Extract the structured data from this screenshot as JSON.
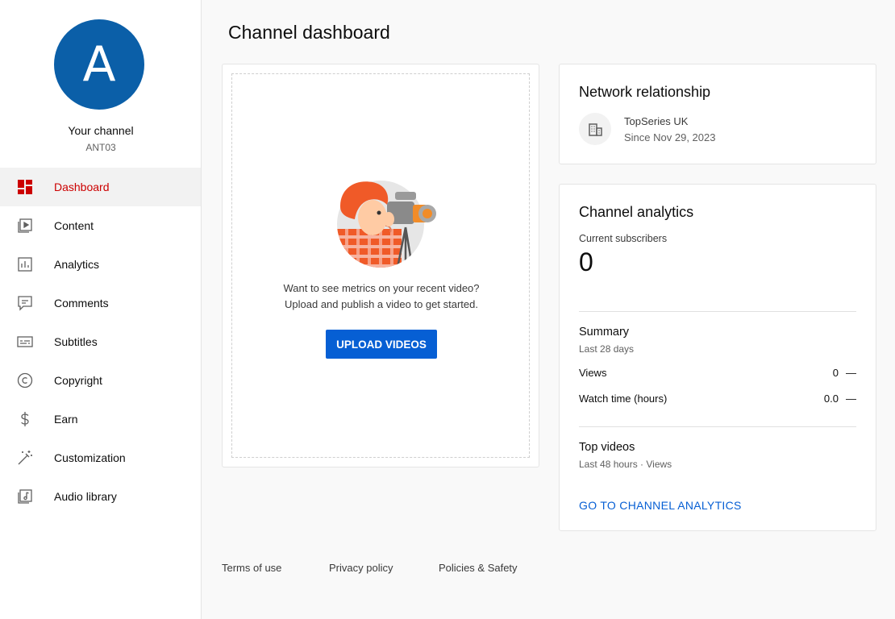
{
  "sidebar": {
    "avatar_letter": "A",
    "channel_title": "Your channel",
    "channel_handle": "ANT03",
    "items": [
      {
        "label": "Dashboard",
        "icon": "dashboard-icon",
        "active": true
      },
      {
        "label": "Content",
        "icon": "content-icon"
      },
      {
        "label": "Analytics",
        "icon": "analytics-icon"
      },
      {
        "label": "Comments",
        "icon": "comments-icon"
      },
      {
        "label": "Subtitles",
        "icon": "subtitles-icon"
      },
      {
        "label": "Copyright",
        "icon": "copyright-icon"
      },
      {
        "label": "Earn",
        "icon": "earn-icon"
      },
      {
        "label": "Customization",
        "icon": "customization-icon"
      },
      {
        "label": "Audio library",
        "icon": "audio-library-icon"
      }
    ]
  },
  "main": {
    "page_title": "Channel dashboard",
    "upload_card": {
      "line1": "Want to see metrics on your recent video?",
      "line2": "Upload and publish a video to get started.",
      "button_label": "UPLOAD VIDEOS"
    },
    "network_card": {
      "title": "Network relationship",
      "network_name": "TopSeries UK",
      "since": "Since Nov 29, 2023"
    },
    "analytics_card": {
      "title": "Channel analytics",
      "subscribers_label": "Current subscribers",
      "subscribers_value": "0",
      "summary_title": "Summary",
      "summary_period": "Last 28 days",
      "rows": [
        {
          "label": "Views",
          "value": "0",
          "trend": "—"
        },
        {
          "label": "Watch time (hours)",
          "value": "0.0",
          "trend": "—"
        }
      ],
      "top_videos_title": "Top videos",
      "top_videos_period": "Last 48 hours · Views",
      "link_label": "GO TO CHANNEL ANALYTICS"
    }
  },
  "footer": {
    "links": [
      "Terms of use",
      "Privacy policy",
      "Policies & Safety"
    ]
  },
  "colors": {
    "accent_red": "#cc0000",
    "link_blue": "#065fd4",
    "avatar_blue": "#0b5fa8"
  }
}
